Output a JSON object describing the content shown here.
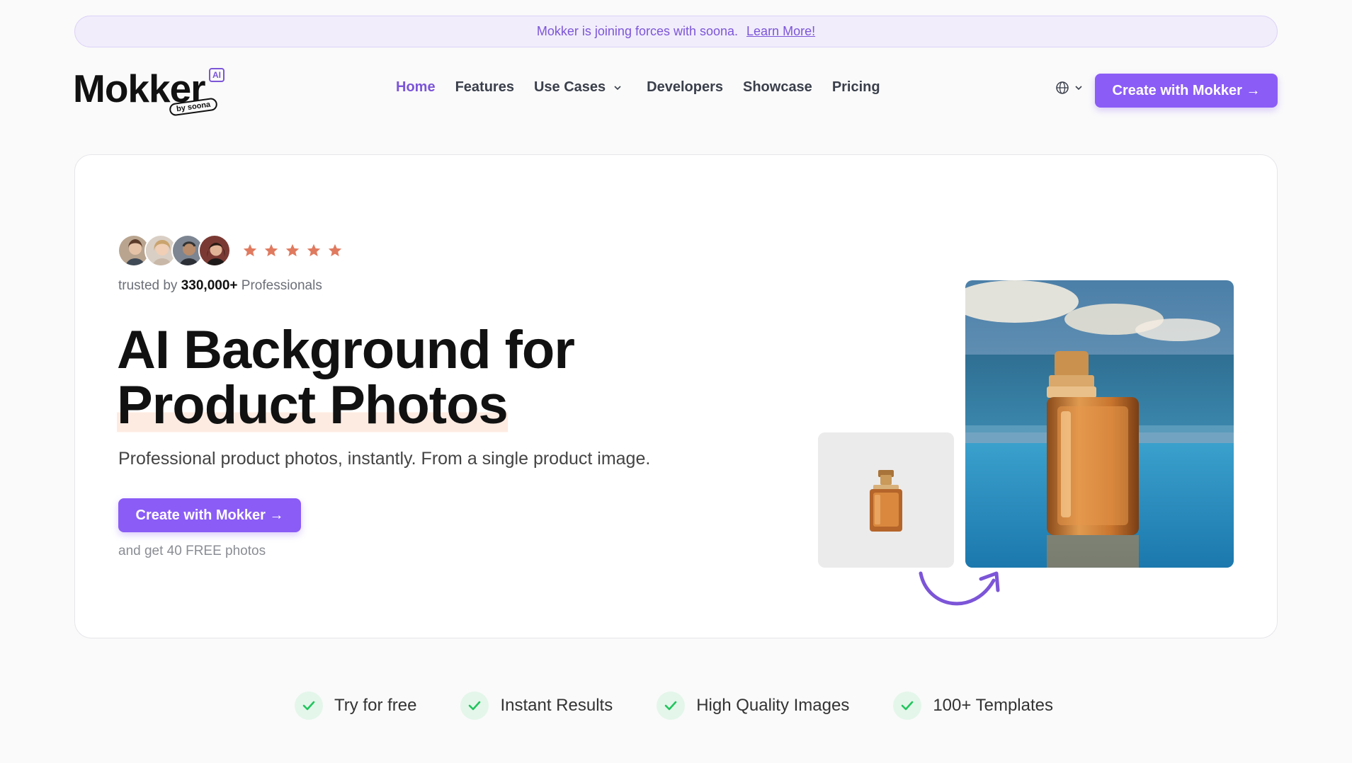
{
  "banner": {
    "text": "Mokker is joining forces with soona.",
    "link": "Learn More!"
  },
  "logo": {
    "name": "Mokker",
    "badge": "AI",
    "tag": "by soona"
  },
  "nav": {
    "items": [
      {
        "label": "Home",
        "active": true
      },
      {
        "label": "Features"
      },
      {
        "label": "Use Cases",
        "dropdown": true
      },
      {
        "label": "Developers"
      },
      {
        "label": "Showcase"
      },
      {
        "label": "Pricing"
      }
    ],
    "cta": "Create with Mokker →"
  },
  "hero": {
    "rating_stars": 5,
    "trusted_prefix": "trusted by",
    "trusted_count": "330,000+",
    "trusted_suffix": "Professionals",
    "title_line1": "AI Background for",
    "title_line2": "Product Photos",
    "subtitle": "Professional product photos, instantly. From a single product image.",
    "cta": "Create with Mokker →",
    "note": "and get 40 FREE photos"
  },
  "features": [
    {
      "label": "Try for free"
    },
    {
      "label": "Instant Results"
    },
    {
      "label": "High Quality Images"
    },
    {
      "label": "100+ Templates"
    }
  ],
  "colors": {
    "accent": "#8b5cf6",
    "star": "#e07a5f",
    "check": "#22c55e"
  }
}
